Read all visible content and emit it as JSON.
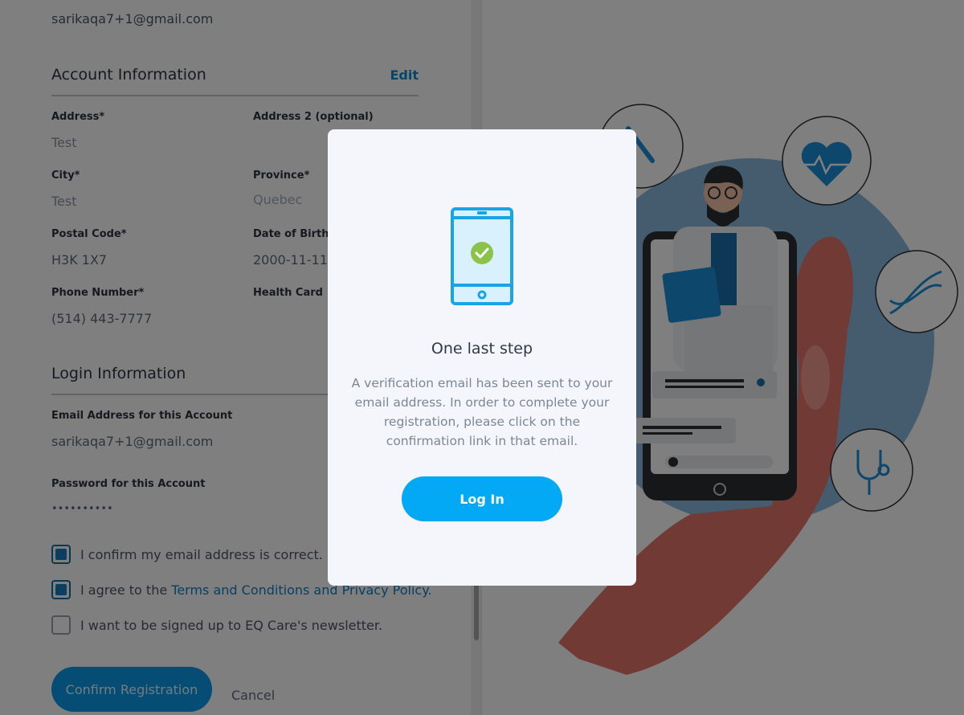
{
  "form": {
    "top_email": "sarikaqa7+1@gmail.com",
    "account": {
      "title": "Account Information",
      "edit_label": "Edit",
      "fields": {
        "address": {
          "label": "Address*",
          "value": "Test"
        },
        "address2": {
          "label": "Address 2 (optional)",
          "value": ""
        },
        "city": {
          "label": "City*",
          "value": "Test"
        },
        "province": {
          "label": "Province*",
          "value": "Quebec"
        },
        "postal": {
          "label": "Postal Code*",
          "value": "H3K 1X7"
        },
        "dob": {
          "label": "Date of Birth*",
          "value": "2000-11-11"
        },
        "phone": {
          "label": "Phone Number*",
          "value": "(514) 443-7777"
        },
        "health": {
          "label": "Health Card",
          "value": ""
        }
      }
    },
    "login": {
      "title": "Login Information",
      "email_label": "Email Address for this Account",
      "email_value": "sarikaqa7+1@gmail.com",
      "password_label": "Password for this Account",
      "password_value": "••••••••••"
    },
    "checkboxes": [
      {
        "text": "I confirm my email address is correct.",
        "checked": true
      },
      {
        "text_prefix": "I agree to the ",
        "link": "Terms and Conditions and Privacy Policy",
        "text_suffix": ".",
        "checked": true
      },
      {
        "text": "I want to be signed up to EQ Care's newsletter.",
        "checked": false
      }
    ],
    "confirm_label": "Confirm Registration",
    "cancel_label": "Cancel"
  },
  "modal": {
    "title": "One last step",
    "message": "A verification email has been sent to your email address. In order to complete your registration, please click on the confirmation link in that email.",
    "message_lines": [
      "A verification email has been sent to your",
      "email address. In order to complete your",
      "registration, please click on the",
      "confirmation link in that email."
    ],
    "login_label": "Log In"
  },
  "colors": {
    "accent": "#03a9f4",
    "link": "#0f8ad0",
    "check_green": "#8bc34a",
    "illustration_blue": "#1a6fa8",
    "illustration_hand": "#e2756a"
  },
  "icons": [
    "phone-check-icon",
    "heart-pulse-icon",
    "dna-icon",
    "stethoscope-icon",
    "syringe-icon"
  ]
}
